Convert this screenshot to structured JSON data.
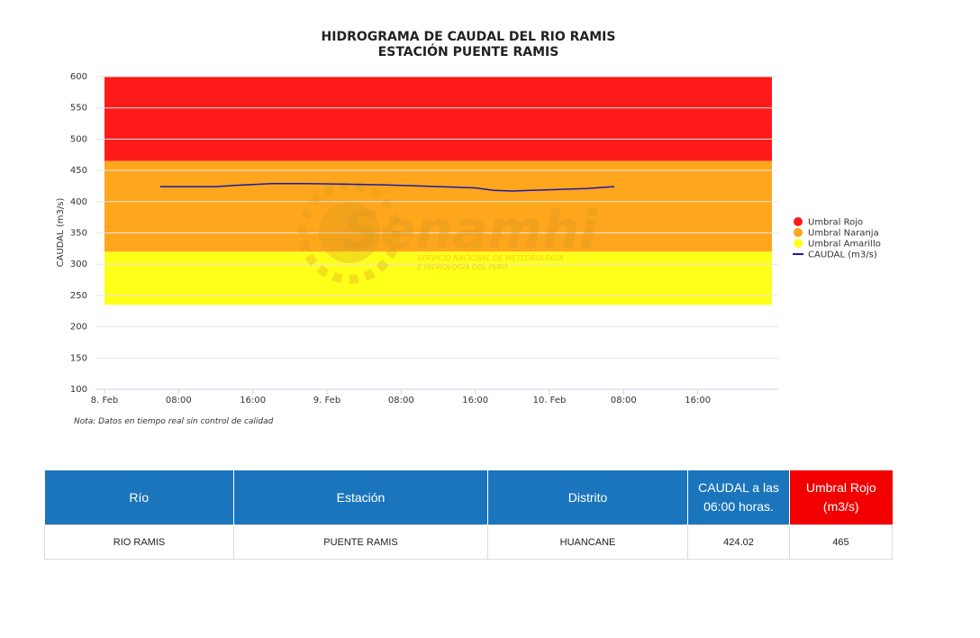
{
  "chart_data": {
    "type": "line",
    "title": "HIDROGRAMA DE CAUDAL DEL RIO RAMIS",
    "subtitle": "ESTACIÓN PUENTE RAMIS",
    "ylabel": "CAUDAL (m3/s)",
    "ylim": [
      100,
      600
    ],
    "yticks": [
      100,
      150,
      200,
      250,
      300,
      350,
      400,
      450,
      500,
      550,
      600
    ],
    "xlim_hours": [
      0,
      72
    ],
    "xticks": [
      {
        "h": 0,
        "label": "8. Feb"
      },
      {
        "h": 8,
        "label": "08:00"
      },
      {
        "h": 16,
        "label": "16:00"
      },
      {
        "h": 24,
        "label": "9. Feb"
      },
      {
        "h": 32,
        "label": "08:00"
      },
      {
        "h": 40,
        "label": "16:00"
      },
      {
        "h": 48,
        "label": "10. Feb"
      },
      {
        "h": 56,
        "label": "08:00"
      },
      {
        "h": 64,
        "label": "16:00"
      }
    ],
    "bands": [
      {
        "name": "Umbral Rojo",
        "from": 465,
        "to": 600,
        "color": "#ff1a1a"
      },
      {
        "name": "Umbral Naranja",
        "from": 320,
        "to": 465,
        "color": "#ffa61c"
      },
      {
        "name": "Umbral Amarillo",
        "from": 235,
        "to": 320,
        "color": "#ffff1a"
      }
    ],
    "series": [
      {
        "name": "CAUDAL (m3/s)",
        "color": "#1a1aaa",
        "points": [
          [
            6,
            424
          ],
          [
            8,
            424
          ],
          [
            12,
            424
          ],
          [
            14,
            426
          ],
          [
            18,
            429
          ],
          [
            22,
            429
          ],
          [
            26,
            428
          ],
          [
            30,
            427
          ],
          [
            34,
            425
          ],
          [
            36,
            424
          ],
          [
            38,
            423
          ],
          [
            40,
            422
          ],
          [
            42,
            418
          ],
          [
            44,
            417
          ],
          [
            46,
            418
          ],
          [
            48,
            419
          ],
          [
            50,
            420
          ],
          [
            52,
            421
          ],
          [
            54,
            423
          ],
          [
            55,
            424
          ]
        ]
      }
    ],
    "legend": [
      {
        "label": "Umbral Rojo",
        "color": "#ff1a1a",
        "kind": "dot"
      },
      {
        "label": "Umbral Naranja",
        "color": "#ffa61c",
        "kind": "dot"
      },
      {
        "label": "Umbral Amarillo",
        "color": "#ffff1a",
        "kind": "dot"
      },
      {
        "label": "CAUDAL (m3/s)",
        "color": "#1a1aaa",
        "kind": "line"
      }
    ],
    "legend_position": "right",
    "note": "Nota: Datos en tiempo real sin control de calidad"
  },
  "watermark": {
    "brand": "Senamhi",
    "line1": "SERVICIO NACIONAL DE METEOROLOGÍA",
    "line2": "E HIDROLOGÍA DEL PERÚ"
  },
  "table": {
    "headers": [
      "Río",
      "Estación",
      "Distrito",
      "CAUDAL a las 06:00 horas.",
      "Umbral Rojo (m3/s)"
    ],
    "row": [
      "RIO RAMIS",
      "PUENTE RAMIS",
      "HUANCANE",
      "424.02",
      "465"
    ]
  }
}
